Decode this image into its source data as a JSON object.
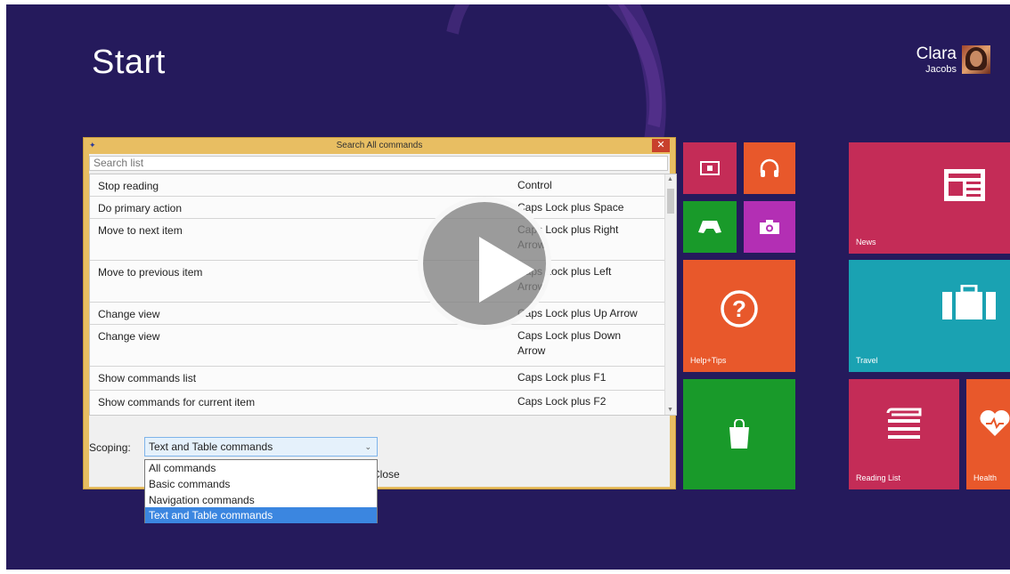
{
  "start": {
    "title": "Start"
  },
  "user": {
    "first_name": "Clara",
    "last_name": "Jacobs"
  },
  "colors": {
    "background": "#251a5c",
    "dialog_frame": "#e8be62",
    "tile_magenta": "#c42c57",
    "tile_orange": "#e8582b",
    "tile_green": "#199a2a",
    "tile_purple": "#b32fb4",
    "tile_teal": "#1aa2b2",
    "selection": "#3b86e0"
  },
  "tiles": {
    "news": "News",
    "travel": "Travel",
    "help": "Help+Tips",
    "reading_list": "Reading List",
    "health": "Health"
  },
  "dialog": {
    "title": "Search All commands",
    "search_placeholder": "Search list",
    "close_glyph": "✕",
    "commands": [
      {
        "name": "Stop reading",
        "keys": "Control"
      },
      {
        "name": "Do primary action",
        "keys": "Caps Lock plus Space"
      },
      {
        "name": "Move to next item",
        "keys": "Caps Lock plus Right Arrow"
      },
      {
        "name": "Move to previous item",
        "keys": "Caps Lock plus Left Arrow"
      },
      {
        "name": "Change view",
        "keys": "Caps Lock plus Up Arrow"
      },
      {
        "name": "Change view",
        "keys": "Caps Lock plus Down Arrow"
      },
      {
        "name": "Show commands list",
        "keys": "Caps Lock plus F1"
      },
      {
        "name": "Show commands for current item",
        "keys": "Caps Lock plus F2"
      }
    ],
    "scoping_label": "Scoping:",
    "scoping_value": "Text and Table commands",
    "close_button": "Close",
    "scoping_options": [
      "All commands",
      "Basic commands",
      "Navigation commands",
      "Text and Table commands"
    ]
  },
  "video": {
    "play_icon": "play-icon"
  }
}
